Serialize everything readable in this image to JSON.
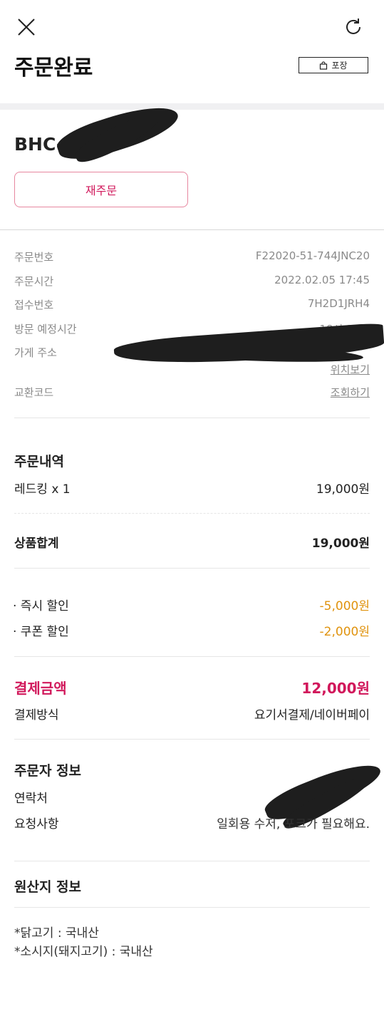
{
  "header": {
    "title": "주문완료",
    "packaging_badge": "포장",
    "close_icon": "close-icon",
    "refresh_icon": "refresh-icon"
  },
  "store": {
    "name": "BHC-",
    "reorder_label": "재주문"
  },
  "order_info": {
    "order_number_label": "주문번호",
    "order_number": "F22020-51-744JNC20",
    "order_time_label": "주문시간",
    "order_time": "2022.02.05 17:45",
    "receipt_number_label": "접수번호",
    "receipt_number": "7H2D1JRH4",
    "visit_time_label": "방문 예정시간",
    "visit_time": "18시 30분",
    "address_label": "가게 주소",
    "location_link": "위치보기",
    "exchange_code_label": "교환코드",
    "exchange_code_link": "조회하기"
  },
  "order_details": {
    "title": "주문내역",
    "items": [
      {
        "name": "레드킹 x 1",
        "price": "19,000원"
      }
    ],
    "subtotal_label": "상품합계",
    "subtotal": "19,000원"
  },
  "discounts": [
    {
      "label": "· 즉시 할인",
      "amount": "-5,000원"
    },
    {
      "label": "· 쿠폰 할인",
      "amount": "-2,000원"
    }
  ],
  "payment": {
    "total_label": "결제금액",
    "total": "12,000원",
    "method_label": "결제방식",
    "method": "요기서결제/네이버페이"
  },
  "orderer": {
    "title": "주문자 정보",
    "contact_label": "연락처",
    "request_label": "요청사항",
    "request": "일회용 수저, 포크가 필요해요."
  },
  "origin": {
    "title": "원산지 정보",
    "lines": [
      "*닭고기 : 국내산",
      "*소시지(돼지고기) : 국내산"
    ]
  },
  "colors": {
    "accent": "#d1185b",
    "discount": "#e0930e",
    "muted": "#8a8a8a"
  }
}
